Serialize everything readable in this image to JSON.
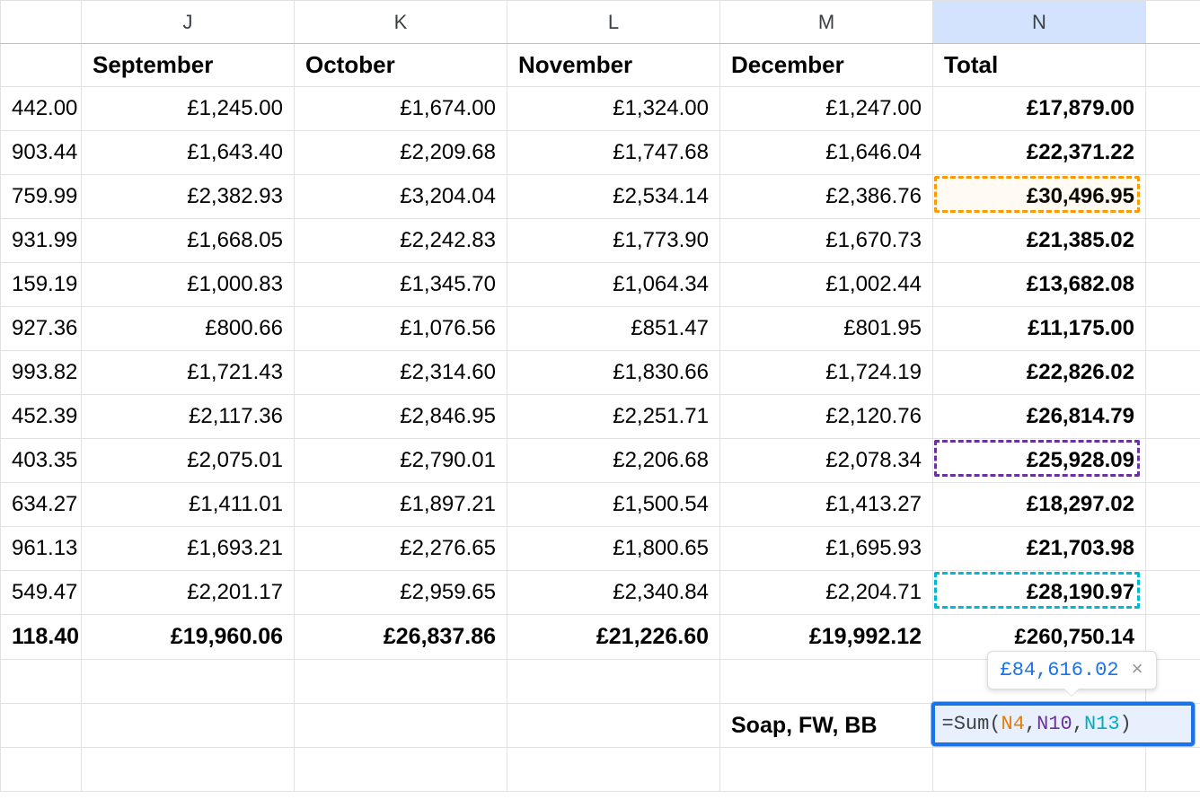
{
  "columns": [
    "",
    "J",
    "K",
    "L",
    "M",
    "N",
    ""
  ],
  "selected_col_index": 5,
  "header_labels": [
    "",
    "September",
    "October",
    "November",
    "December",
    "Total",
    ""
  ],
  "rows": [
    {
      "partial": "442.00",
      "j": "£1,245.00",
      "k": "£1,674.00",
      "l": "£1,324.00",
      "m": "£1,247.00",
      "n": "£17,879.00"
    },
    {
      "partial": "903.44",
      "j": "£1,643.40",
      "k": "£2,209.68",
      "l": "£1,747.68",
      "m": "£1,646.04",
      "n": "£22,371.22"
    },
    {
      "partial": "759.99",
      "j": "£2,382.93",
      "k": "£3,204.04",
      "l": "£2,534.14",
      "m": "£2,386.76",
      "n": "£30,496.95"
    },
    {
      "partial": "931.99",
      "j": "£1,668.05",
      "k": "£2,242.83",
      "l": "£1,773.90",
      "m": "£1,670.73",
      "n": "£21,385.02"
    },
    {
      "partial": "159.19",
      "j": "£1,000.83",
      "k": "£1,345.70",
      "l": "£1,064.34",
      "m": "£1,002.44",
      "n": "£13,682.08"
    },
    {
      "partial": "927.36",
      "j": "£800.66",
      "k": "£1,076.56",
      "l": "£851.47",
      "m": "£801.95",
      "n": "£11,175.00"
    },
    {
      "partial": "993.82",
      "j": "£1,721.43",
      "k": "£2,314.60",
      "l": "£1,830.66",
      "m": "£1,724.19",
      "n": "£22,826.02"
    },
    {
      "partial": "452.39",
      "j": "£2,117.36",
      "k": "£2,846.95",
      "l": "£2,251.71",
      "m": "£2,120.76",
      "n": "£26,814.79"
    },
    {
      "partial": "403.35",
      "j": "£2,075.01",
      "k": "£2,790.01",
      "l": "£2,206.68",
      "m": "£2,078.34",
      "n": "£25,928.09"
    },
    {
      "partial": "634.27",
      "j": "£1,411.01",
      "k": "£1,897.21",
      "l": "£1,500.54",
      "m": "£1,413.27",
      "n": "£18,297.02"
    },
    {
      "partial": "961.13",
      "j": "£1,693.21",
      "k": "£2,276.65",
      "l": "£1,800.65",
      "m": "£1,695.93",
      "n": "£21,703.98"
    },
    {
      "partial": "549.47",
      "j": "£2,201.17",
      "k": "£2,959.65",
      "l": "£2,340.84",
      "m": "£2,204.71",
      "n": "£28,190.97"
    }
  ],
  "total_row": {
    "partial": "118.40",
    "j": "£19,960.06",
    "k": "£26,837.86",
    "l": "£21,226.60",
    "m": "£19,992.12",
    "n": "£260,750.14"
  },
  "label_row": {
    "m": "Soap, FW, BB"
  },
  "formula": {
    "raw": "=Sum(N4,N10,N13)",
    "eq": "=",
    "fn": "Sum",
    "open": "(",
    "ref1": "N4",
    "comma": ",",
    "ref2": "N10",
    "ref3": "N13",
    "close": ")",
    "result": "£84,616.02"
  },
  "highlights": {
    "orange_ref": "N4",
    "purple_ref": "N10",
    "cyan_ref": "N13"
  }
}
